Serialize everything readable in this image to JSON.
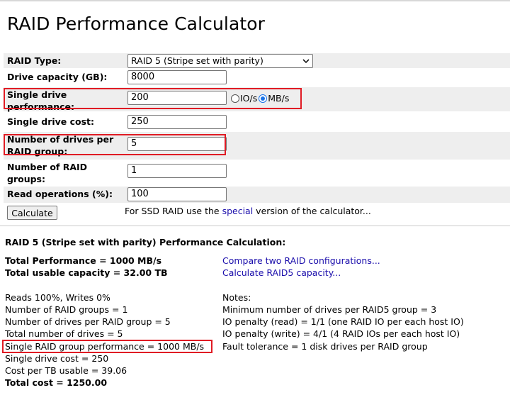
{
  "title": "RAID Performance Calculator",
  "form": {
    "raid_type_label": "RAID Type:",
    "raid_type_value": "RAID 5 (Stripe set with parity)",
    "drive_capacity_label": "Drive capacity (GB):",
    "drive_capacity_value": "8000",
    "single_perf_label": "Single drive performance:",
    "single_perf_value": "200",
    "unit_iops": "IO/s",
    "unit_mbs": "MB/s",
    "unit_selected": "MB/s",
    "single_cost_label": "Single drive cost:",
    "single_cost_value": "250",
    "drives_per_group_label": "Number of drives per RAID group:",
    "drives_per_group_value": "5",
    "raid_groups_label": "Number of RAID groups:",
    "raid_groups_value": "1",
    "read_ops_label": "Read operations (%):",
    "read_ops_value": "100",
    "calculate_button": "Calculate",
    "ssd_hint_prefix": "For SSD RAID use the ",
    "ssd_hint_link": "special",
    "ssd_hint_suffix": " version of the calculator..."
  },
  "results": {
    "heading": "RAID 5 (Stripe set with parity) Performance Calculation:",
    "total_performance": "Total Performance = 1000 MB/s",
    "total_capacity": "Total usable capacity = 32.00 TB",
    "compare_link": "Compare two RAID configurations...",
    "capacity_link": "Calculate RAID5 capacity...",
    "left_lines": [
      "Reads 100%, Writes 0%",
      "Number of RAID groups = 1",
      "Number of drives per RAID group = 5",
      "Total number of drives = 5",
      "Single RAID group performance = 1000 MB/s",
      "Single drive cost = 250",
      "Cost per TB usable = 39.06"
    ],
    "total_cost": "Total cost = 1250.00",
    "notes_heading": "Notes:",
    "notes": [
      "Minimum number of drives per RAID5 group = 3",
      "IO penalty (read) = 1/1 (one RAID IO per each host IO)",
      "IO penalty (write) = 4/1 (4 RAID IOs per each host IO)",
      "Fault tolerance = 1 disk drives per RAID group"
    ]
  },
  "colors": {
    "highlight": "#e01b24",
    "link": "#1a0dab",
    "row_shade": "#eeeeee",
    "radio_accent": "#1a73e8"
  }
}
